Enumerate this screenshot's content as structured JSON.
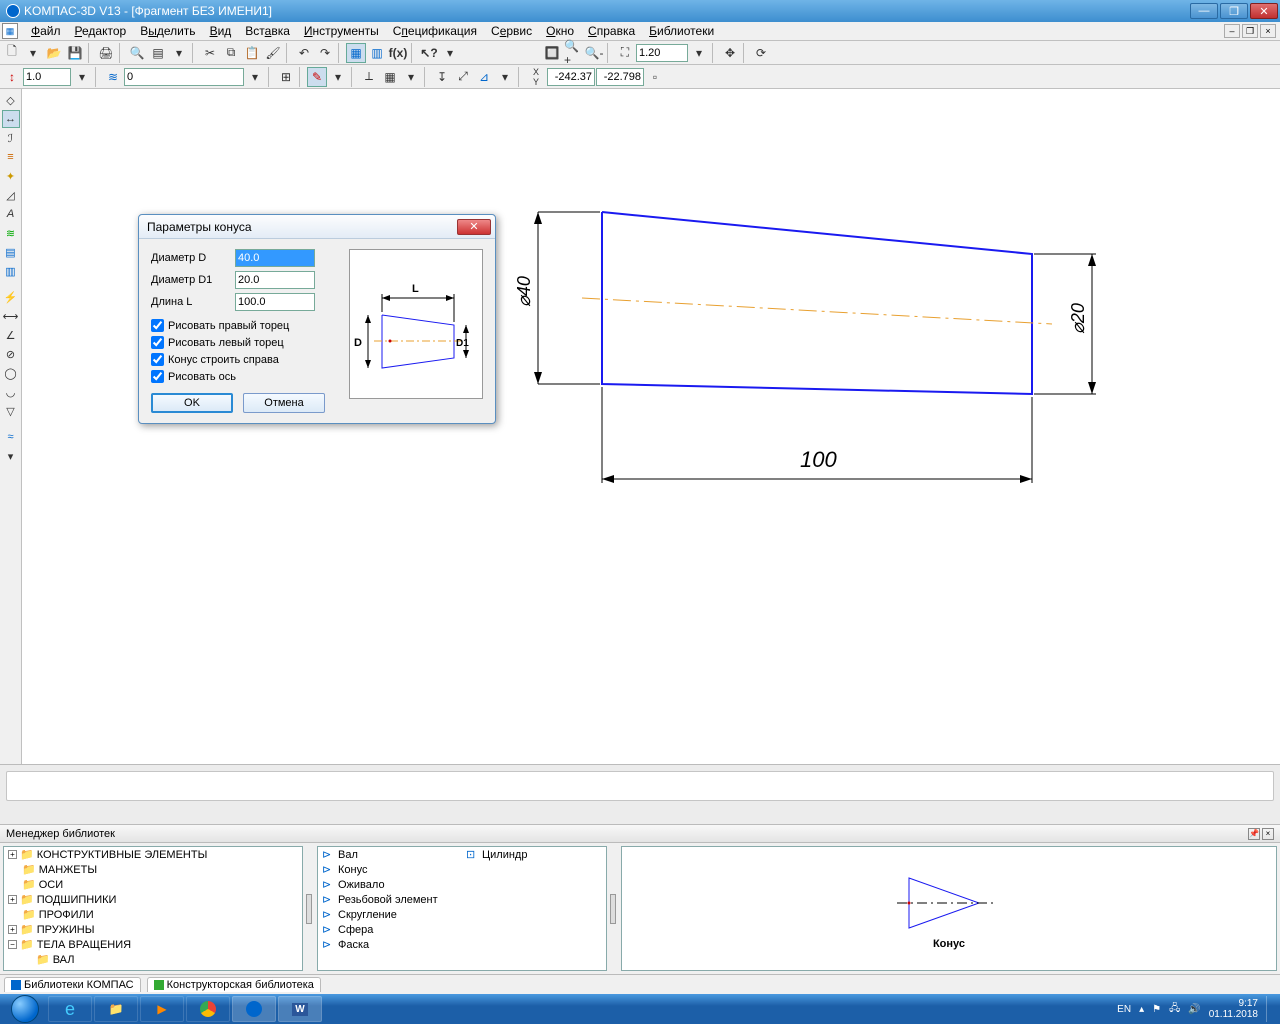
{
  "titlebar": {
    "text": "KOMПAC-3D V13 - [Фрагмент БЕЗ ИМЕНИ1]"
  },
  "menu": {
    "items": [
      "Файл",
      "Редактор",
      "Выделить",
      "Вид",
      "Вставка",
      "Инструменты",
      "Спецификация",
      "Сервис",
      "Окно",
      "Справка",
      "Библиотеки"
    ]
  },
  "toolrow2": {
    "coord": "1.0",
    "layer": "0",
    "cx": "-242.37",
    "cy": "-22.798"
  },
  "zoom": "1.20",
  "dialog": {
    "title": "Параметры конуса",
    "labels": {
      "d": "Диаметр D",
      "d1": "Диаметр D1",
      "l": "Длина L"
    },
    "values": {
      "d": "40.0",
      "d1": "20.0",
      "l": "100.0"
    },
    "checks": {
      "right_face": "Рисовать правый торец",
      "left_face": "Рисовать левый торец",
      "build_right": "Конус строить справа",
      "draw_axis": "Рисовать ось"
    },
    "ok": "OK",
    "cancel": "Отмена",
    "preview": {
      "L": "L",
      "D": "D",
      "D1": "D1"
    }
  },
  "drawing": {
    "dim40": "⌀40",
    "dim20": "⌀20",
    "dim100": "100"
  },
  "strip_label": "",
  "lib": {
    "title": "Менеджер библиотек",
    "tree": [
      {
        "t": "КОНСТРУКТИВНЫЕ ЭЛЕМЕНТЫ",
        "exp": "+",
        "i": 0
      },
      {
        "t": "МАНЖЕТЫ",
        "exp": "",
        "i": 0
      },
      {
        "t": "ОСИ",
        "exp": "",
        "i": 0
      },
      {
        "t": "ПОДШИПНИКИ",
        "exp": "+",
        "i": 0
      },
      {
        "t": "ПРОФИЛИ",
        "exp": "",
        "i": 0
      },
      {
        "t": "ПРУЖИНЫ",
        "exp": "+",
        "i": 0
      },
      {
        "t": "ТЕЛА ВРАЩЕНИЯ",
        "exp": "−",
        "i": 0
      },
      {
        "t": "ВАЛ",
        "exp": "",
        "i": 1
      }
    ],
    "list_left": [
      "Вал",
      "Конус",
      "Оживало",
      "Резьбовой элемент",
      "Скругление",
      "Сфера",
      "Фаска"
    ],
    "list_right": [
      "Цилиндр"
    ],
    "preview_caption": "Конус",
    "tabs": [
      "Библиотеки КОМПАС",
      "Конструкторская библиотека"
    ]
  },
  "tray": {
    "lang": "EN",
    "time": "9:17",
    "date": "01.11.2018"
  }
}
